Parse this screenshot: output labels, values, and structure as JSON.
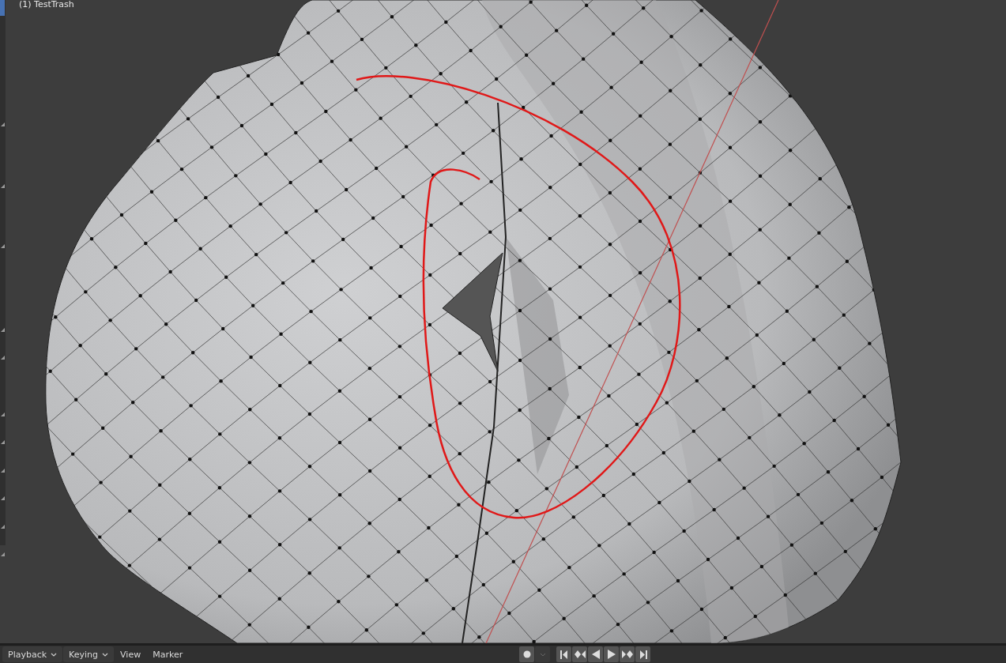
{
  "viewport": {
    "object_label": "(1) TestTrash"
  },
  "timeline": {
    "menus": [
      {
        "label": "Playback",
        "kind": "dropdown"
      },
      {
        "label": "Keying",
        "kind": "dropdown"
      },
      {
        "label": "View",
        "kind": "plain"
      },
      {
        "label": "Marker",
        "kind": "plain"
      }
    ]
  }
}
